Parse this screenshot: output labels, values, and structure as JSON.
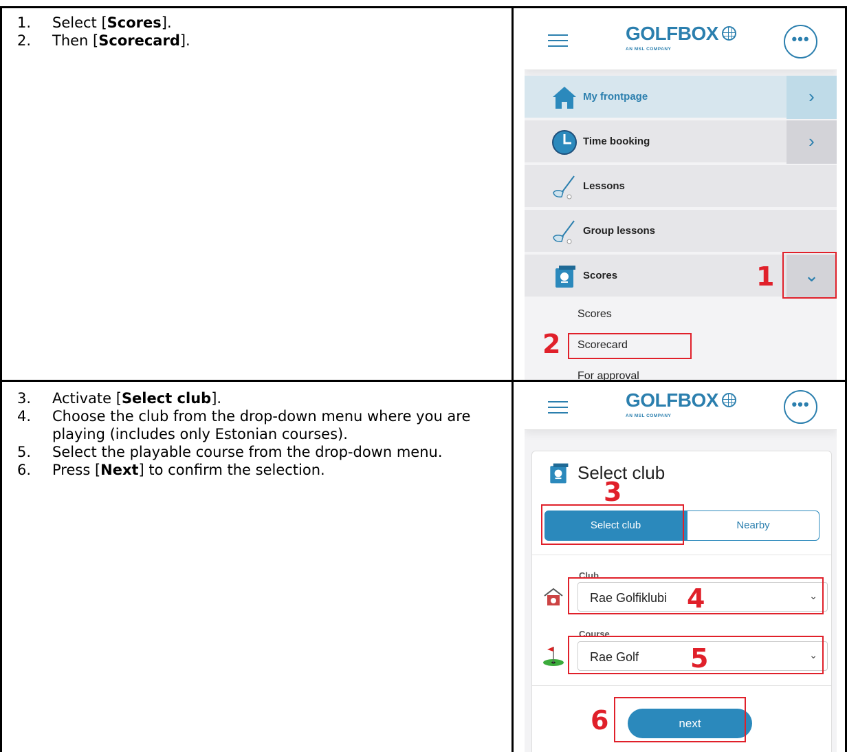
{
  "step_group_1": {
    "steps": [
      {
        "num": "1.",
        "before": "Select [",
        "bold": "Scores",
        "after": "]."
      },
      {
        "num": "2.",
        "before": "Then [",
        "bold": "Scorecard",
        "after": "]."
      }
    ]
  },
  "step_group_2": {
    "steps": [
      {
        "num": "3.",
        "before": "Activate [",
        "bold": "Select club",
        "after": "]."
      },
      {
        "num": "4.",
        "before": "Choose the club from the drop-down menu where you are playing (includes only Estonian courses).",
        "bold": "",
        "after": ""
      },
      {
        "num": "5.",
        "before": "Select the playable course from the drop-down menu.",
        "bold": "",
        "after": ""
      },
      {
        "num": "6.",
        "before": "Press [",
        "bold": "Next",
        "after": "] to confirm the selection."
      }
    ]
  },
  "app": {
    "logo": "GOLFBOX",
    "logo_sub": "AN MSL COMPANY",
    "more_label": "•••"
  },
  "menu": {
    "items": [
      {
        "label": "My frontpage",
        "icon": "home-icon",
        "arrow": "›",
        "active": true
      },
      {
        "label": "Time booking",
        "icon": "clock-icon",
        "arrow": "›"
      },
      {
        "label": "Lessons",
        "icon": "golf-club-icon"
      },
      {
        "label": "Group lessons",
        "icon": "golf-club-icon"
      },
      {
        "label": "Scores",
        "icon": "scorecard-icon",
        "arrow": "⌄"
      }
    ],
    "sub_items": [
      "Scores",
      "Scorecard",
      "For approval"
    ]
  },
  "select_club": {
    "title": "Select club",
    "tab_select": "Select club",
    "tab_nearby": "Nearby",
    "club_label": "Club",
    "club_value": "Rae Golfiklubi",
    "course_label": "Course",
    "course_value": "Rae Golf",
    "chevron": "⌄",
    "next_label": "next"
  },
  "annotations": [
    "1",
    "2",
    "3",
    "4",
    "5",
    "6"
  ],
  "colors": {
    "brand": "#2b7fae",
    "button": "#2b89bc",
    "annotation": "#e0202a"
  }
}
